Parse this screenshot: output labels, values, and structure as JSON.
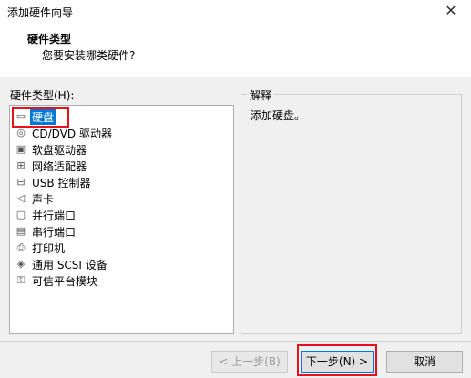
{
  "window": {
    "title": "添加硬件向导",
    "close_glyph": "✕"
  },
  "header": {
    "title": "硬件类型",
    "subtitle": "您要安装哪类硬件?"
  },
  "list": {
    "label": "硬件类型(H):",
    "items": [
      {
        "label": "硬盘",
        "icon": "hard-disk-icon",
        "glyph": "▭",
        "selected": true
      },
      {
        "label": "CD/DVD 驱动器",
        "icon": "cd-dvd-icon",
        "glyph": "◎",
        "selected": false
      },
      {
        "label": "软盘驱动器",
        "icon": "floppy-icon",
        "glyph": "▣",
        "selected": false
      },
      {
        "label": "网络适配器",
        "icon": "network-adapter-icon",
        "glyph": "⊞",
        "selected": false
      },
      {
        "label": "USB 控制器",
        "icon": "usb-icon",
        "glyph": "⊟",
        "selected": false
      },
      {
        "label": "声卡",
        "icon": "sound-icon",
        "glyph": "◁",
        "selected": false
      },
      {
        "label": "并行端口",
        "icon": "parallel-port-icon",
        "glyph": "▢",
        "selected": false
      },
      {
        "label": "串行端口",
        "icon": "serial-port-icon",
        "glyph": "▤",
        "selected": false
      },
      {
        "label": "打印机",
        "icon": "printer-icon",
        "glyph": "⎙",
        "selected": false
      },
      {
        "label": "通用 SCSI 设备",
        "icon": "scsi-icon",
        "glyph": "◈",
        "selected": false
      },
      {
        "label": "可信平台模块",
        "icon": "tpm-icon",
        "glyph": "⚿",
        "selected": false
      }
    ]
  },
  "explanation": {
    "legend": "解释",
    "text": "添加硬盘。"
  },
  "buttons": {
    "back": "< 上一步(B)",
    "next": "下一步(N) >",
    "cancel": "取消"
  }
}
